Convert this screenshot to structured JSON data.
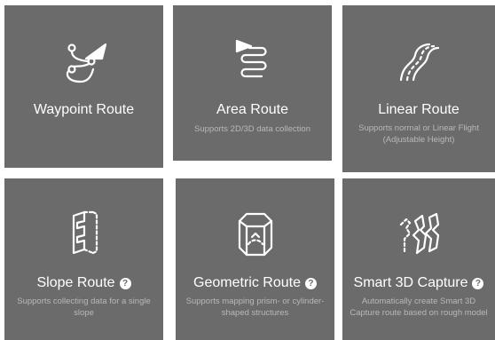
{
  "routes": [
    {
      "title": "Waypoint Route",
      "desc": "",
      "icon": "waypoint-route-icon",
      "help": false
    },
    {
      "title": "Area Route",
      "desc": "Supports 2D/3D data collection",
      "icon": "area-route-icon",
      "help": false
    },
    {
      "title": "Linear Route",
      "desc": "Supports normal or Linear Flight (Adjustable Height)",
      "icon": "linear-route-icon",
      "help": false
    },
    {
      "title": "Slope Route",
      "desc": "Supports collecting data for a single slope",
      "icon": "slope-route-icon",
      "help": true
    },
    {
      "title": "Geometric Route",
      "desc": "Supports mapping prism- or cylinder-shaped structures",
      "icon": "geometric-route-icon",
      "help": true
    },
    {
      "title": "Smart 3D Capture",
      "desc": "Automatically create Smart 3D Capture route based on rough model",
      "icon": "smart-3d-capture-icon",
      "help": true
    }
  ],
  "help_glyph": "?",
  "colors": {
    "card": "#6b6b6b",
    "text": "#ffffff",
    "desc": "#b8b8b8"
  }
}
